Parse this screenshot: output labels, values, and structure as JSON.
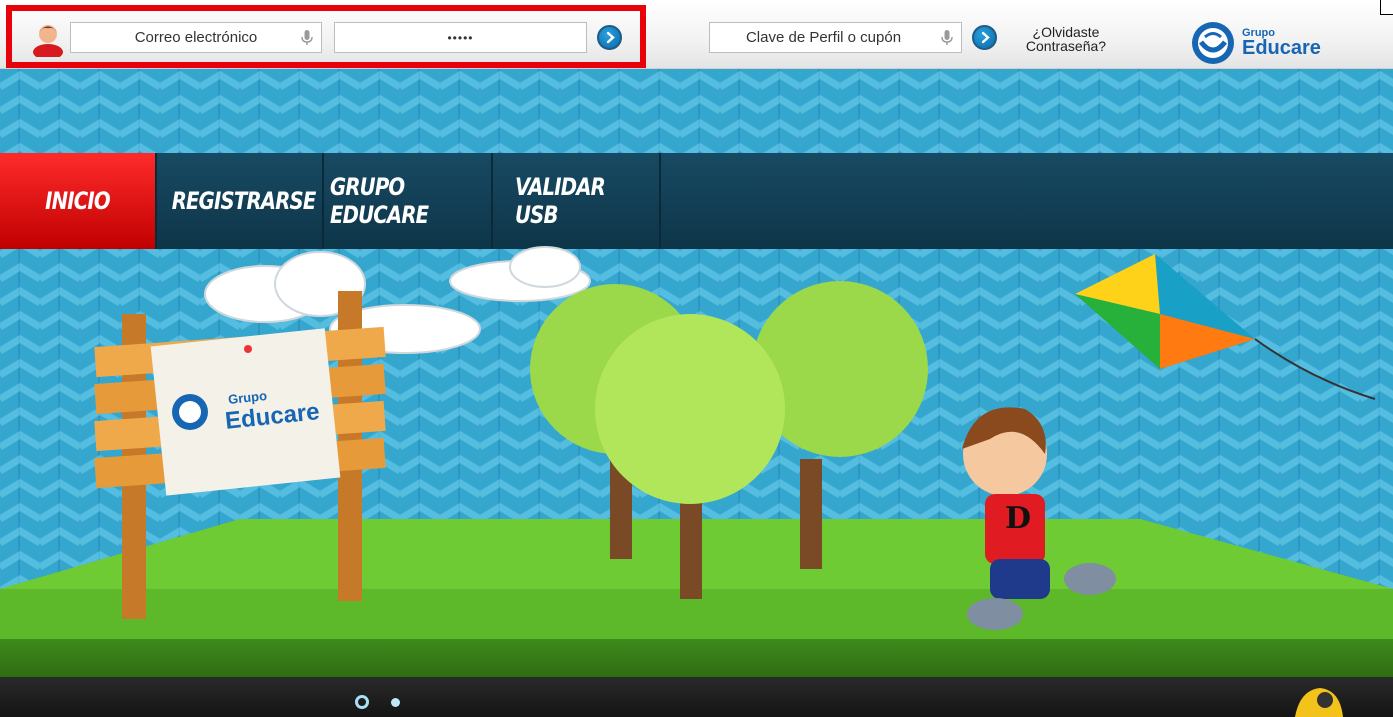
{
  "login": {
    "email_placeholder": "Correo electrónico",
    "password_value": "•••••",
    "submit_icon": "arrow-right-icon"
  },
  "profile": {
    "coupon_placeholder": "Clave de Perfil o cupón",
    "submit_icon": "arrow-right-icon"
  },
  "forgot": {
    "line1": "¿Olvidaste",
    "line2": "Contraseña?"
  },
  "brand": {
    "grupo": "Grupo",
    "educare": "Educare"
  },
  "nav": {
    "items": [
      {
        "label": "INICIO",
        "active": true
      },
      {
        "label": "REGISTRARSE",
        "active": false
      },
      {
        "label": "GRUPO EDUCARE",
        "active": false
      },
      {
        "label": "VALIDAR USB",
        "active": false
      }
    ]
  },
  "sign": {
    "grupo": "Grupo",
    "educare": "Educare",
    "character_letter": "D"
  },
  "slider": {
    "slides": 2,
    "active": 1
  },
  "colors": {
    "accent_red": "#e8000b",
    "brand_blue": "#1766b3",
    "nav_bg": "#174a63",
    "sky": "#35a7cf",
    "grass": "#5db82a"
  }
}
